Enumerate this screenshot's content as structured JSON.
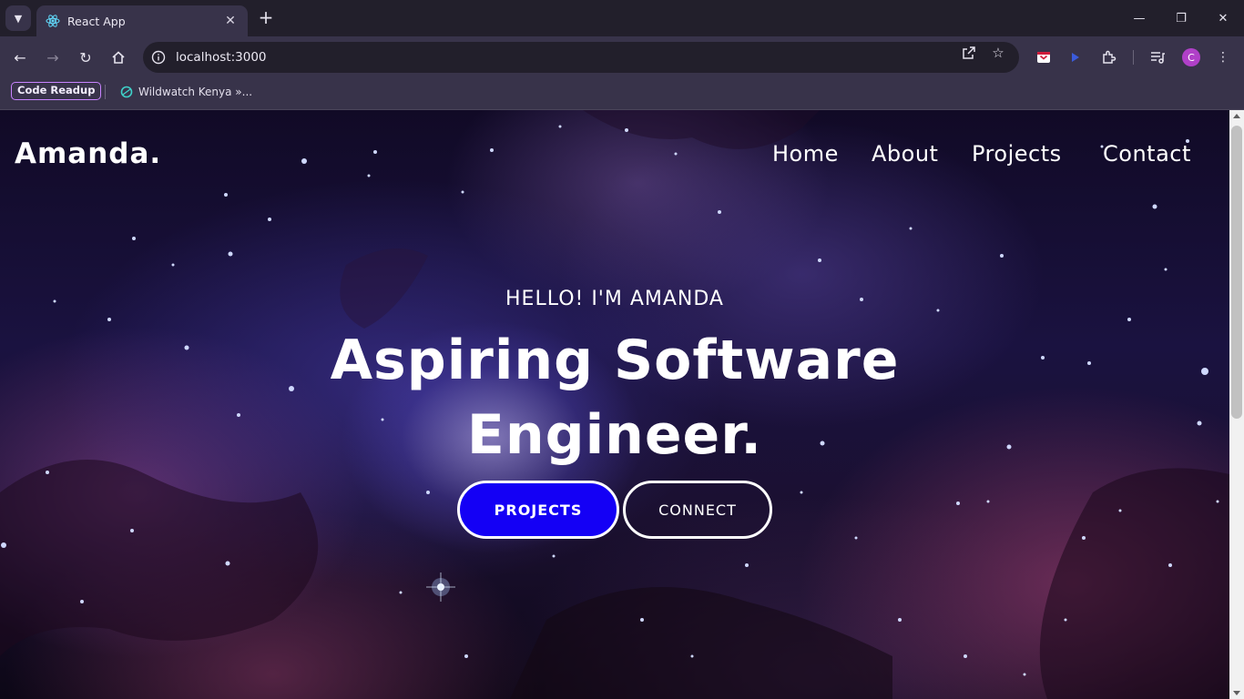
{
  "browser": {
    "tab": {
      "title": "React App"
    },
    "address": {
      "url": "localhost:3000"
    },
    "bookmarks": [
      {
        "label": "Code Readup"
      },
      {
        "label": "Wildwatch Kenya »..."
      }
    ],
    "profile_initial": "C",
    "accent": "#c884ff"
  },
  "site": {
    "logo": "Amanda.",
    "nav": [
      "Home",
      "About",
      "Projects",
      "Contact"
    ],
    "hero": {
      "greeting": "HELLO! I'M AMANDA",
      "headline_line1": "Aspiring Software",
      "headline_line2": "Engineer.",
      "primary_button": "PROJECTS",
      "secondary_button": "CONNECT"
    },
    "colors": {
      "primary_button_bg": "#1400f5",
      "text": "#ffffff"
    }
  }
}
